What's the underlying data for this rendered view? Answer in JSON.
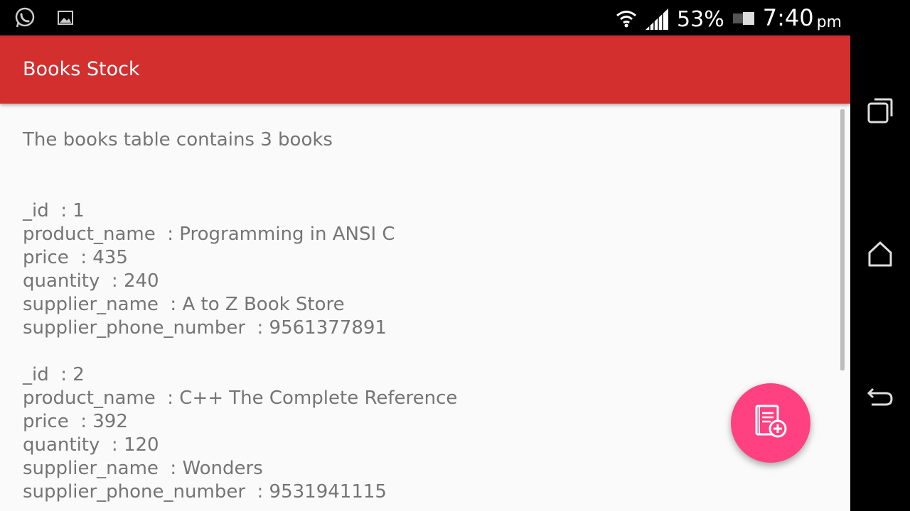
{
  "status_bar": {
    "icons": [
      "whatsapp-icon",
      "gallery-icon",
      "wifi-icon",
      "signal-icon",
      "battery-icon"
    ],
    "battery": "53%",
    "time": "7:40",
    "ampm": "pm"
  },
  "app_bar": {
    "title": "Books Stock",
    "color": "#D32F2F"
  },
  "content": {
    "summary": "The books table contains 3 books",
    "records": [
      {
        "id": "_id  : 1",
        "product_name": "product_name  : Programming in ANSI C",
        "price": "price  : 435",
        "quantity": "quantity  : 240",
        "supplier_name": "supplier_name  : A to Z Book Store",
        "supplier_phone_number": "supplier_phone_number  : 9561377891"
      },
      {
        "id": "_id  : 2",
        "product_name": "product_name  : C++ The Complete Reference",
        "price": "price  : 392",
        "quantity": "quantity  : 120",
        "supplier_name": "supplier_name  : Wonders",
        "supplier_phone_number": "supplier_phone_number  : 9531941115"
      }
    ]
  },
  "fab": {
    "icon": "add-book-icon",
    "color": "#FF4081"
  },
  "nav_bar": {
    "buttons": [
      "recents-icon",
      "home-icon",
      "back-icon"
    ]
  }
}
